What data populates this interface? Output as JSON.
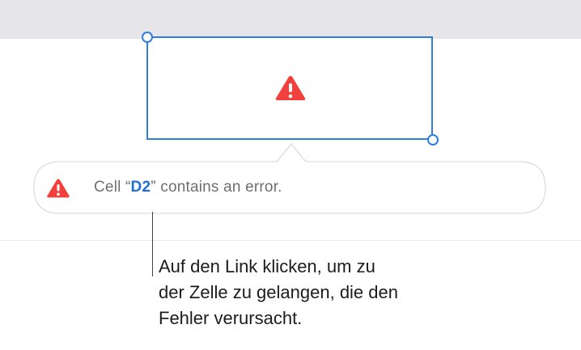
{
  "popover": {
    "prefix": "Cell “",
    "cell_ref": "D2",
    "suffix": "” contains an error.",
    "icon": "warning-triangle-icon"
  },
  "callout": {
    "lines": [
      "Auf den Link klicken, um zu",
      "der Zelle zu gelangen, die den",
      "Fehler verursacht."
    ]
  },
  "colors": {
    "selection": "#2f7de1",
    "error": "#f2403c",
    "link": "#1f6fd0",
    "toolbar": "#e5e5ea"
  }
}
